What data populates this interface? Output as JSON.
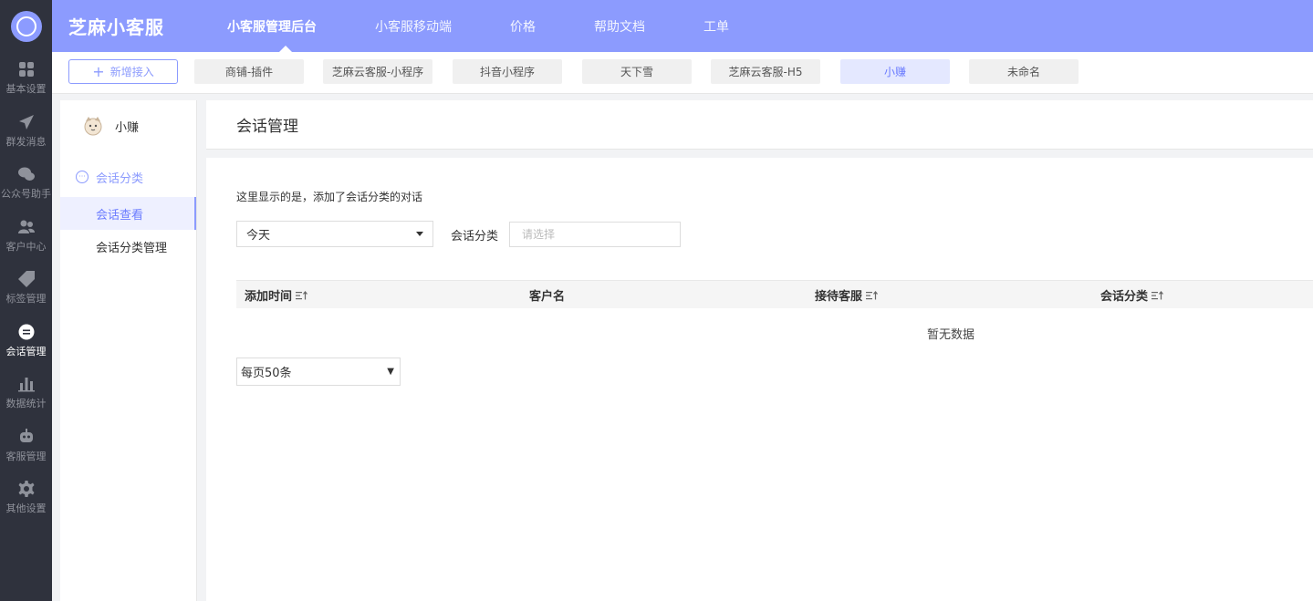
{
  "app": {
    "brand": "芝麻小客服"
  },
  "topnav": [
    {
      "label": "小客服管理后台",
      "active": true
    },
    {
      "label": "小客服移动端"
    },
    {
      "label": "价格"
    },
    {
      "label": "帮助文档"
    },
    {
      "label": "工单"
    }
  ],
  "rail": [
    {
      "label": "基本设置",
      "icon": "grid-icon"
    },
    {
      "label": "群发消息",
      "icon": "paper-plane-icon"
    },
    {
      "label": "公众号助手",
      "icon": "wechat-icon"
    },
    {
      "label": "客户中心",
      "icon": "users-icon"
    },
    {
      "label": "标签管理",
      "icon": "tag-icon"
    },
    {
      "label": "会话管理",
      "icon": "chat-icon",
      "active": true
    },
    {
      "label": "数据统计",
      "icon": "bar-chart-icon"
    },
    {
      "label": "客服管理",
      "icon": "robot-icon"
    },
    {
      "label": "其他设置",
      "icon": "gear-icon"
    }
  ],
  "tabs": {
    "add_label": "新增接入",
    "items": [
      {
        "label": "商铺-插件"
      },
      {
        "label": "芝麻云客服-小程序"
      },
      {
        "label": "抖音小程序"
      },
      {
        "label": "天下雪"
      },
      {
        "label": "芝麻云客服-H5"
      },
      {
        "label": "小赚",
        "active": true
      },
      {
        "label": "未命名"
      }
    ]
  },
  "subside": {
    "account_name": "小赚",
    "group_label": "会话分类",
    "items": [
      {
        "label": "会话查看",
        "active": true
      },
      {
        "label": "会话分类管理"
      }
    ]
  },
  "main": {
    "title": "会话管理",
    "hint": "这里显示的是，添加了会话分类的对话",
    "date_filter": "今天",
    "category_label": "会话分类",
    "category_placeholder": "请选择",
    "columns": [
      {
        "label": "添加时间",
        "sortable": true
      },
      {
        "label": "客户名",
        "sortable": false
      },
      {
        "label": "接待客服",
        "sortable": true
      },
      {
        "label": "会话分类",
        "sortable": true
      }
    ],
    "empty_text": "暂无数据",
    "page_size": "每页50条"
  },
  "colors": {
    "accent": "#8c9bfe",
    "rail_bg": "#2f323d"
  }
}
